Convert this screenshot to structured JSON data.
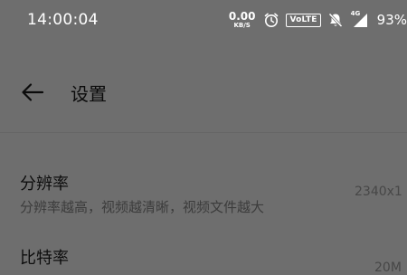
{
  "status_bar": {
    "time": "14:00:04",
    "net_speed_value": "0.00",
    "net_speed_unit": "KB/S",
    "volte": "VoLTE",
    "network_type": "4G",
    "battery": "93%"
  },
  "header": {
    "title": "设置"
  },
  "settings": [
    {
      "title": "分辨率",
      "description": "分辨率越高，视频越清晰，视频文件越大",
      "value": "2340x1"
    },
    {
      "title": "比特率",
      "value": "20M"
    }
  ]
}
